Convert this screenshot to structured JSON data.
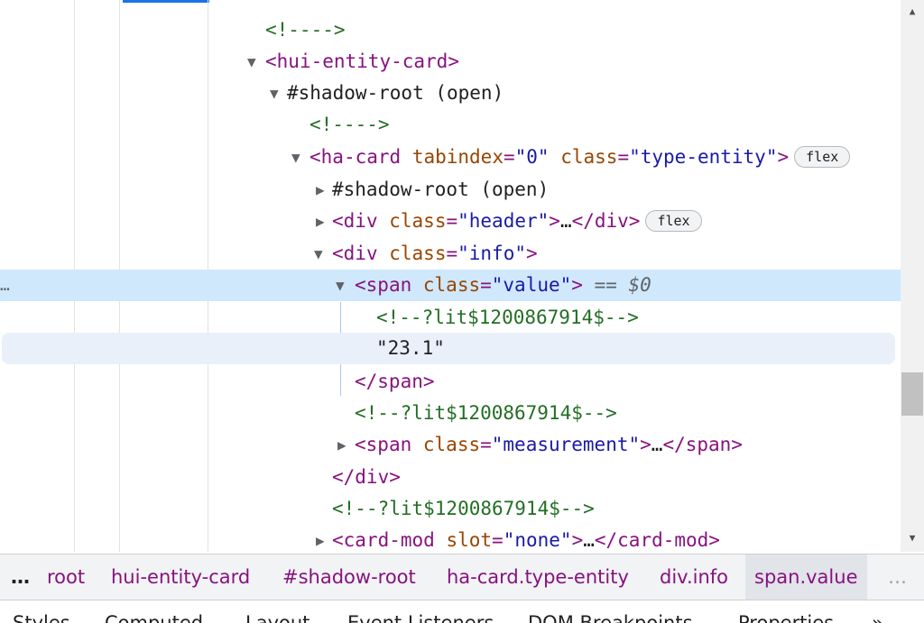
{
  "dom_tree": {
    "rows": [
      {
        "kind": "comment",
        "text": "<!---->"
      },
      {
        "kind": "tag_open",
        "name": "hui-entity-card"
      },
      {
        "kind": "pseudo",
        "text": "#shadow-root (open)"
      },
      {
        "kind": "comment",
        "text": "<!---->"
      },
      {
        "kind": "tag_open",
        "name": "ha-card",
        "attr1_name": "tabindex",
        "attr1_value": "\"0\"",
        "attr2_name": "class",
        "attr2_value": "\"type-entity\"",
        "badge": "flex"
      },
      {
        "kind": "pseudo",
        "text": "#shadow-root (open)"
      },
      {
        "kind": "tag_collapsed",
        "name": "div",
        "attr_name": "class",
        "attr_value": "\"header\"",
        "close": "</div>",
        "badge": "flex"
      },
      {
        "kind": "tag_open",
        "name": "div",
        "attr_name": "class",
        "attr_value": "\"info\""
      },
      {
        "kind": "tag_open_selected",
        "name": "span",
        "attr_name": "class",
        "attr_value": "\"value\"",
        "selected_marker": "== $0",
        "row_menu": "…"
      },
      {
        "kind": "comment",
        "text": "<!--?lit$1200867914$-->"
      },
      {
        "kind": "text",
        "text": "\"23.1\""
      },
      {
        "kind": "tag_close",
        "text": "</span>"
      },
      {
        "kind": "comment",
        "text": "<!--?lit$1200867914$-->"
      },
      {
        "kind": "tag_collapsed",
        "name": "span",
        "attr_name": "class",
        "attr_value": "\"measurement\"",
        "close": "</span>"
      },
      {
        "kind": "tag_close",
        "text": "</div>"
      },
      {
        "kind": "comment",
        "text": "<!--?lit$1200867914$-->"
      },
      {
        "kind": "tag_collapsed",
        "name": "card-mod",
        "attr_name": "slot",
        "attr_value": "\"none\"",
        "close": "</card-mod>"
      }
    ],
    "ellipsis": "…",
    "expanded_icon": "triangle-down-icon",
    "collapsed_icon": "triangle-right-icon"
  },
  "breadcrumbs": {
    "more_left": "…",
    "items": [
      "root",
      "hui-entity-card",
      "#shadow-root",
      "ha-card.type-entity",
      "div.info",
      "span.value"
    ],
    "selected_index": 5,
    "more_right": "…"
  },
  "panel_tabs": [
    "Styles",
    "Computed",
    "Layout",
    "Event Listeners",
    "DOM Breakpoints",
    "Properties"
  ],
  "panel_tabs_overflow": "»",
  "colors": {
    "tag": "#881280",
    "attr_name": "#994500",
    "attr_value": "#1a1aa6",
    "comment": "#236e25",
    "selection": "#cfe8fc",
    "hover": "#eaf0fa",
    "accent": "#1a73e8"
  }
}
